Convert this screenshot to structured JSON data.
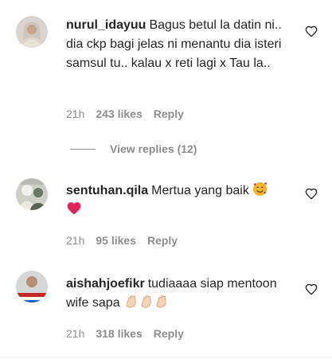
{
  "comments": [
    {
      "username": "nurul_idayuu",
      "text": "Bagus betul la datin ni.. dia ckp bagi jelas ni menantu dia isteri samsul tu.. kalau x reti lagi x Tau la..",
      "time": "21h",
      "likes": "243 likes",
      "reply": "Reply",
      "view_replies": "View replies (12)"
    },
    {
      "username": "sentuhan.qila",
      "text": "Mertua yang baik",
      "emojis": [
        "smiling-face-with-hearts",
        "red-heart"
      ],
      "time": "21h",
      "likes": "95 likes",
      "reply": "Reply"
    },
    {
      "username": "aishahjoefikr",
      "text": "tudiaaaa siap mentoon wife sapa",
      "emojis": [
        "clapping-hands",
        "clapping-hands",
        "clapping-hands"
      ],
      "time": "21h",
      "likes": "318 likes",
      "reply": "Reply"
    }
  ],
  "colors": {
    "text": "#262626",
    "secondary": "#8e8e8e",
    "heart_emoji": "#e0245e",
    "smile_emoji": "#f5b72a"
  }
}
